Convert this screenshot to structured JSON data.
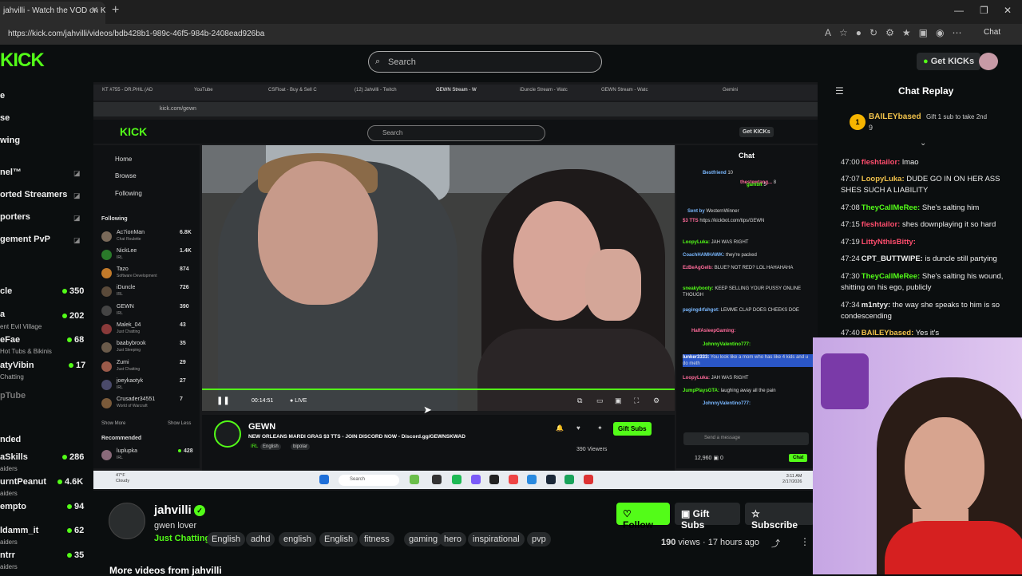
{
  "browser": {
    "tab_title": "jahvilli - Watch the VOD on Ki",
    "url": "https://kick.com/jahvilli/videos/bdb428b1-989c-46f5-984b-2408ead926ba",
    "chat_label": "Chat"
  },
  "kick": {
    "logo": "KICK",
    "search_placeholder": "Search",
    "get_kicks": "Get KICKs"
  },
  "left_nav": {
    "items": [
      "e",
      "se",
      "wing"
    ],
    "followed": [
      {
        "name": "nel™"
      },
      {
        "name": "orted Streamers"
      },
      {
        "name": "porters"
      },
      {
        "name": "gement PvP"
      }
    ],
    "channels": [
      {
        "name": "cle",
        "sub": "",
        "count": "350"
      },
      {
        "name": "a",
        "sub": "ent Evil Village",
        "count": "202"
      },
      {
        "name": "eFae",
        "sub": "Hot Tubs & Bikinis",
        "count": "68"
      },
      {
        "name": "atyVibin",
        "sub": "Chatting",
        "count": "17"
      },
      {
        "name": "pTube",
        "sub": "",
        "count": ""
      }
    ],
    "recommended_heading": "nded",
    "recommended": [
      {
        "name": "aSkills",
        "sub": "aiders",
        "count": "286"
      },
      {
        "name": "urntPeanut",
        "sub": "aiders",
        "count": "4.6K"
      },
      {
        "name": "empto",
        "sub": "",
        "count": "94"
      },
      {
        "name": "ldamm_it",
        "sub": "aiders",
        "count": "62"
      },
      {
        "name": "ntrr",
        "sub": "aiders",
        "count": "35"
      }
    ]
  },
  "inner": {
    "tabs": [
      "KT #755 - DR.PHIL (AD",
      "YouTube",
      "CSFloat - Buy & Sell C",
      "(12) Jahvilli - Twitch",
      "GEWN Stream - W",
      "iDuncle Stream - Watc",
      "GEWN Stream - Watc",
      "Gemini"
    ],
    "url": "kick.com/gewn",
    "logo": "KICK",
    "search": "Search",
    "get_kicks": "Get KICKs",
    "nav": [
      "Home",
      "Browse",
      "Following"
    ],
    "following_heading": "Following",
    "following": [
      {
        "name": "Ac7ionMan",
        "sub": "Chat Roulette",
        "count": "6.8K",
        "color": "#7a6a5a"
      },
      {
        "name": "NickLee",
        "sub": "IRL",
        "count": "1.4K",
        "color": "#2a7a2a"
      },
      {
        "name": "Tazo",
        "sub": "Software Development",
        "count": "874",
        "color": "#c27a2a"
      },
      {
        "name": "iDuncle",
        "sub": "IRL",
        "count": "726",
        "color": "#5a4a3a"
      },
      {
        "name": "GEWN",
        "sub": "IRL",
        "count": "390",
        "color": "#444444"
      },
      {
        "name": "Malek_04",
        "sub": "Just Chatting",
        "count": "43",
        "color": "#8a3a3a"
      },
      {
        "name": "baabybrook",
        "sub": "Just Sleeping",
        "count": "35",
        "color": "#6a5a4a"
      },
      {
        "name": "Zumi",
        "sub": "Just Chatting",
        "count": "29",
        "color": "#9a5a4a"
      },
      {
        "name": "joeykaotyk",
        "sub": "IRL",
        "count": "27",
        "color": "#4a4a6a"
      },
      {
        "name": "Crusader34551",
        "sub": "World of Warcraft",
        "count": "7",
        "color": "#7a5a3a"
      }
    ],
    "show_more": "Show More",
    "show_less": "Show Less",
    "recommended_heading": "Recommended",
    "recommended": [
      {
        "name": "luplupka",
        "sub": "IRL",
        "count": "428",
        "color": "#8a6a7a"
      }
    ],
    "video_time": "00:14:51",
    "video_live": "LIVE",
    "streamer": "GEWN",
    "stream_title": "NEW ORLEANS MARDI GRAS $3 TTS - JOIN DISCORD NOW - Discord.gg/GEWNSKWAD",
    "tags": [
      "IRL",
      "English",
      "bipolar"
    ],
    "gift_subs": "Gift Subs",
    "viewers": "390 Viewers",
    "chat_title": "Chat",
    "chat": [
      {
        "user": "Bestfriend",
        "text": "10"
      },
      {
        "user": "thestewtang...",
        "text": "8"
      },
      {
        "user": "gambit",
        "text": "5"
      },
      {
        "user": "Sent by",
        "text": "WesternWinner"
      },
      {
        "user": "$3 TTS",
        "text": "https://kickbot.com/tips/GEWN"
      },
      {
        "user": "LoopyLuka:",
        "text": "JAH WAS RIGHT"
      },
      {
        "user": "CoachHAMHAWK:",
        "text": "they're packed"
      },
      {
        "user": "EzBeAgGelb:",
        "text": "BLUE? NOT RED? LOL HAHAHAHA"
      },
      {
        "user": "sneakybooty:",
        "text": "KEEP SELLING YOUR PUSSY ONLINE THOUGH"
      },
      {
        "user": "pagingdrfahgot:",
        "text": "LEMME CLAP DOES CHEEKS DOE"
      },
      {
        "user": "HalfAsleepGaming:",
        "text": ""
      },
      {
        "user": "JohnnyValentino777:",
        "text": ""
      },
      {
        "user": "lunker3333:",
        "text": "You look like a mom who has like 4 kids and u do meth"
      },
      {
        "user": "LoopyLuka:",
        "text": "JAH WAS RIGHT"
      },
      {
        "user": "JumpPlaysGTA:",
        "text": "laughing away all the pain"
      },
      {
        "user": "JohnnyValentino777:",
        "text": ""
      }
    ],
    "send_placeholder": "Send a message",
    "points": "12,960",
    "points2": "0",
    "chat_button": "Chat"
  },
  "taskbar": {
    "weather": "47°F",
    "weather_sub": "Cloudy",
    "search": "Search",
    "time": "3:11 AM",
    "date": "2/17/2026"
  },
  "vod": {
    "name": "jahvilli",
    "bio": "gwen lover",
    "category": "Just Chatting",
    "tags": [
      "English",
      "adhd",
      "english",
      "English",
      "fitness",
      "gaming",
      "hero",
      "inspirational",
      "pvp"
    ],
    "follow": "Follow",
    "gift_subs": "Gift Subs",
    "subscribe": "Subscribe",
    "views": "190",
    "views_label": "views",
    "time_ago": "17 hours ago",
    "more_videos": "More videos from jahvilli"
  },
  "chat_replay": {
    "title": "Chat Replay",
    "pinned": {
      "user": "BAILEYbased",
      "count": "9",
      "text": "Gift 1 sub to take 2nd"
    },
    "messages": [
      {
        "time": "47:00",
        "user": "fleshtailor:",
        "color": "#ff4d6d",
        "text": "lmao"
      },
      {
        "time": "47:07",
        "user": "LoopyLuka:",
        "color": "#f0c14b",
        "text": "DUDE GO IN ON HER ASS SHES SUCH A LIABILITY"
      },
      {
        "time": "47:08",
        "user": "TheyCallMeRee:",
        "color": "#53fc18",
        "text": "She's salting him"
      },
      {
        "time": "47:15",
        "user": "fleshtailor:",
        "color": "#ff4d6d",
        "text": "shes downplaying it so hard"
      },
      {
        "time": "47:19",
        "user": "LittyNthisBitty:",
        "color": "#ff4d6d",
        "text": ""
      },
      {
        "time": "47:24",
        "user": "CPT_BUTTWIPE:",
        "color": "#eeeeee",
        "text": "is duncle still partying"
      },
      {
        "time": "47:30",
        "user": "TheyCallMeRee:",
        "color": "#53fc18",
        "text": "She's salting his wound, shitting on his ego, publicly"
      },
      {
        "time": "47:34",
        "user": "m1ntyy:",
        "color": "#eeeeee",
        "text": "the way she speaks to him is so condescending"
      },
      {
        "time": "47:40",
        "user": "BAILEYbased:",
        "color": "#f0c14b",
        "text": "Yes it's"
      }
    ]
  }
}
